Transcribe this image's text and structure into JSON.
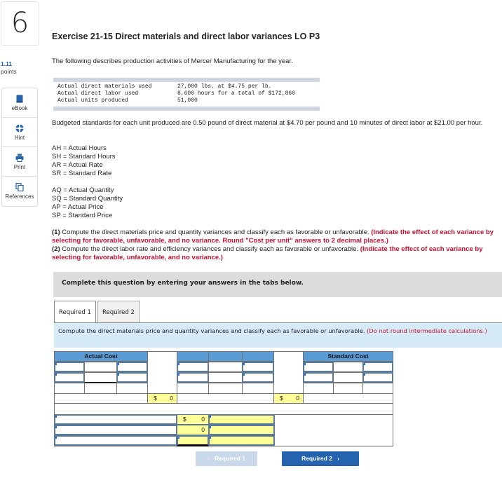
{
  "question": {
    "number": "6",
    "title": "Exercise 21-15 Direct materials and direct labor variances LO P3",
    "points_value": "1.11",
    "points_label": "points"
  },
  "sidebar": {
    "items": [
      {
        "label": "eBook",
        "icon": "book-icon"
      },
      {
        "label": "Hint",
        "icon": "lifebuoy-icon"
      },
      {
        "label": "Print",
        "icon": "printer-icon"
      },
      {
        "label": "References",
        "icon": "copy-documents-icon"
      }
    ]
  },
  "intro": "The following describes production activities of Mercer Manufacturing for the year.",
  "actuals": [
    {
      "label": "Actual direct materials used",
      "value": "27,000 lbs. at $4.75 per lb."
    },
    {
      "label": "Actual direct labor used",
      "value": "8,600 hours for a total of $172,860"
    },
    {
      "label": "Actual units produced",
      "value": "51,000"
    }
  ],
  "budget_text": "Budgeted standards for each unit produced are 0.50 pound of direct material at $4.70 per pound and 10 minutes of direct labor at $21.00 per hour.",
  "definitions_labor": [
    "AH = Actual Hours",
    "SH = Standard Hours",
    "AR = Actual Rate",
    "SR = Standard Rate"
  ],
  "definitions_materials": [
    "AQ = Actual Quantity",
    "SQ = Standard Quantity",
    "AP = Actual Price",
    "SP = Standard Price"
  ],
  "instructions": {
    "p1_num": "(1)",
    "p1_text": " Compute the direct materials price and quantity variances and classify each as favorable or unfavorable. ",
    "p1_red": "(Indicate the effect of each variance by selecting for favorable, unfavorable, and no variance. Round \"Cost per unit\" answers to 2 decimal places.)",
    "p2_num": "(2)",
    "p2_text": " Compute the direct labor rate and efficiency variances and classify each as favorable or unfavorable. ",
    "p2_red": "(Indicate the effect of each variance by selecting for favorable, unfavorable, and no variance.)"
  },
  "complete_bar": "Complete this question by entering your answers in the tabs below.",
  "tabs": [
    {
      "label": "Required 1",
      "active": true
    },
    {
      "label": "Required 2",
      "active": false
    }
  ],
  "required_description": {
    "text": "Compute the direct materials price and quantity variances and classify each as favorable or unfavorable. ",
    "note": "(Do not round intermediate calculations.)"
  },
  "grid": {
    "actual_cost_header": "Actual Cost",
    "middle_header": "",
    "standard_cost_header": "Standard Cost",
    "actual_total_currency": "$",
    "actual_total_value": "0",
    "middle_total_currency": "$",
    "middle_total_value": "0",
    "variance_rows": [
      {
        "currency": "$",
        "value": "0"
      },
      {
        "currency": "",
        "value": "0"
      },
      {
        "currency": "",
        "value": ""
      }
    ]
  },
  "nav": {
    "prev_label": "Required 1",
    "next_label": "Required 2"
  }
}
